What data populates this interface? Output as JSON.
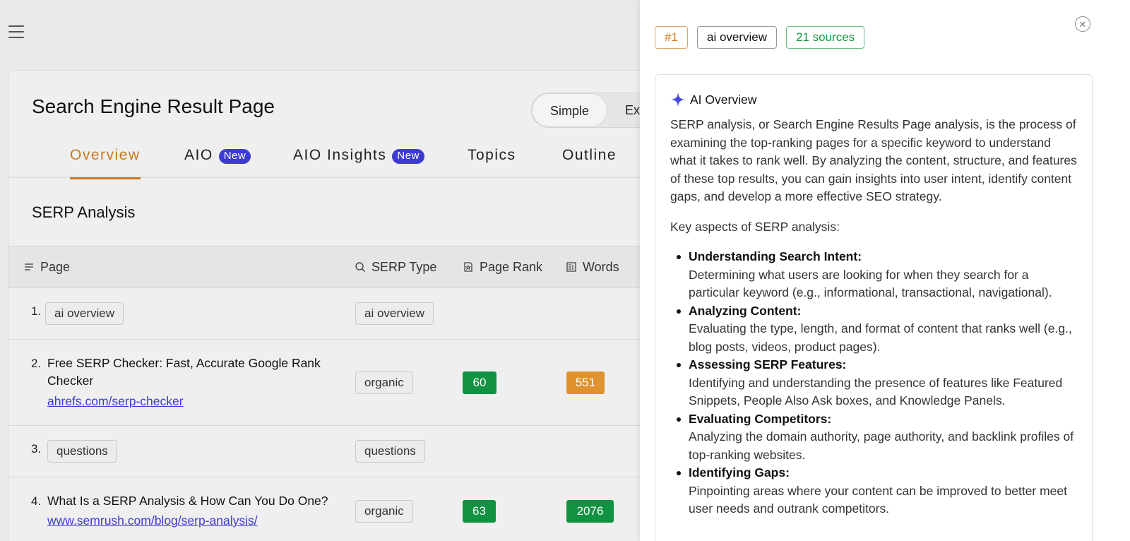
{
  "page": {
    "title": "Search Engine Result Page",
    "view_toggle": {
      "simple": "Simple",
      "extended_partial": "Ext"
    }
  },
  "tabs": [
    {
      "label": "Overview",
      "badge": ""
    },
    {
      "label": "AIO",
      "badge": "New"
    },
    {
      "label": "AIO Insights",
      "badge": "New"
    },
    {
      "label": "Topics",
      "badge": ""
    },
    {
      "label": "Outline",
      "badge": ""
    }
  ],
  "section_title": "SERP Analysis",
  "table": {
    "headers": {
      "page": "Page",
      "serp_type": "SERP Type",
      "page_rank": "Page Rank",
      "words": "Words"
    },
    "rows": [
      {
        "num": "1.",
        "chip": "ai overview",
        "serp_type": "ai overview"
      },
      {
        "num": "2.",
        "title": "Free SERP Checker: Fast, Accurate Google Rank Checker",
        "link": "ahrefs.com/serp-checker",
        "serp_type": "organic",
        "page_rank": "60",
        "words": "551"
      },
      {
        "num": "3.",
        "chip": "questions",
        "serp_type": "questions"
      },
      {
        "num": "4.",
        "title": "What Is a SERP Analysis & How Can You Do One?",
        "link": "www.semrush.com/blog/serp-analysis/",
        "serp_type": "organic",
        "page_rank": "63",
        "words": "2076"
      }
    ]
  },
  "panel": {
    "rank_chip": "#1",
    "type_chip": "ai overview",
    "sources_chip": "21 sources",
    "heading": "AI Overview",
    "intro": "SERP analysis, or Search Engine Results Page analysis, is the process of examining the top-ranking pages for a specific keyword to understand what it takes to rank well. By analyzing the content, structure, and features of these top results, you can gain insights into user intent, identify content gaps, and develop a more effective SEO strategy.",
    "key_aspects_label": "Key aspects of SERP analysis:",
    "aspects": [
      {
        "title": "Understanding Search Intent:",
        "text": "Determining what users are looking for when they search for a particular keyword (e.g., informational, transactional, navigational)."
      },
      {
        "title": "Analyzing Content:",
        "text": "Evaluating the type, length, and format of content that ranks well (e.g., blog posts, videos, product pages)."
      },
      {
        "title": "Assessing SERP Features:",
        "text": "Identifying and understanding the presence of features like Featured Snippets, People Also Ask boxes, and Knowledge Panels."
      },
      {
        "title": "Evaluating Competitors:",
        "text": "Analyzing the domain authority, page authority, and backlink profiles of top-ranking websites."
      },
      {
        "title": "Identifying Gaps:",
        "text": "Pinpointing areas where your content can be improved to better meet user needs and outrank competitors."
      }
    ]
  },
  "colors": {
    "accent_orange": "#c77a22",
    "badge_purple": "#3d3bd1",
    "metric_green": "#119242",
    "metric_orange": "#df922d",
    "sources_green": "#1a9a41"
  },
  "icons": {
    "menu": "hamburger-icon",
    "page_col": "lines-icon",
    "serp_col": "search-icon",
    "rank_col": "badge-icon",
    "words_col": "document-icon",
    "close": "close-icon",
    "sparkle": "sparkle-icon"
  }
}
